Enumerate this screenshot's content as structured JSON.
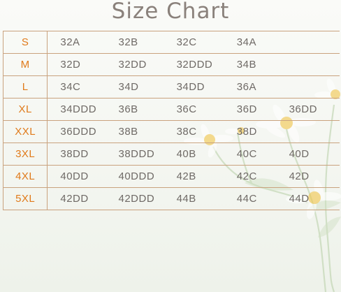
{
  "title": "Size Chart",
  "colors": {
    "size_label": "#e07a1a",
    "cell_text": "#6f6a66",
    "border": "#c9a27e",
    "title": "#8a817b"
  },
  "rows": [
    {
      "size": "S",
      "values": [
        "32A",
        "32B",
        "32C",
        "34A",
        ""
      ]
    },
    {
      "size": "M",
      "values": [
        "32D",
        "32DD",
        "32DDD",
        "34B",
        ""
      ]
    },
    {
      "size": "L",
      "values": [
        "34C",
        "34D",
        "34DD",
        "36A",
        ""
      ]
    },
    {
      "size": "XL",
      "values": [
        "34DDD",
        "36B",
        "36C",
        "36D",
        "36DD"
      ]
    },
    {
      "size": "XXL",
      "values": [
        "36DDD",
        "38B",
        "38C",
        "38D",
        ""
      ]
    },
    {
      "size": "3XL",
      "values": [
        "38DD",
        "38DDD",
        "40B",
        "40C",
        "40D"
      ]
    },
    {
      "size": "4XL",
      "values": [
        "40DD",
        "40DDD",
        "42B",
        "42C",
        "42D"
      ]
    },
    {
      "size": "5XL",
      "values": [
        "42DD",
        "42DDD",
        "44B",
        "44C",
        "44D"
      ]
    }
  ]
}
